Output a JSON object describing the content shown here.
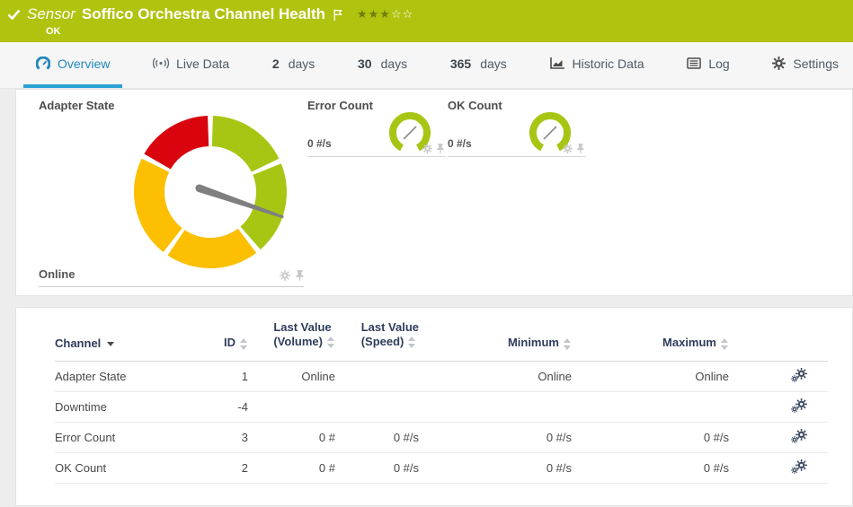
{
  "banner": {
    "type_label": "Sensor",
    "title": "Soffico Orchestra Channel Health",
    "status": "OK",
    "stars_filled": "★★★",
    "stars_empty": "☆☆",
    "color": "#b0c30e"
  },
  "tabs": {
    "overview": "Overview",
    "live_data": "Live Data",
    "days2_num": "2",
    "days2_unit": "days",
    "days30_num": "30",
    "days30_unit": "days",
    "days365_num": "365",
    "days365_unit": "days",
    "historic_data": "Historic Data",
    "log": "Log",
    "settings": "Settings",
    "active_color": "#2187ba"
  },
  "gauges": {
    "main": {
      "title": "Adapter State",
      "value": "Online"
    },
    "error": {
      "title": "Error Count",
      "value": "0 #/s"
    },
    "ok": {
      "title": "OK Count",
      "value": "0 #/s"
    },
    "status_colors": {
      "up_green": "#a7c613",
      "warning_yellow": "#fcbf02",
      "down_red": "#d9040e",
      "needle_gray": "#7f7f7f"
    }
  },
  "table": {
    "headers": {
      "channel": "Channel",
      "id": "ID",
      "last_value_volume_line1": "Last Value",
      "last_value_volume_line2": "(Volume)",
      "last_value_speed_line1": "Last Value",
      "last_value_speed_line2": "(Speed)",
      "minimum": "Minimum",
      "maximum": "Maximum"
    },
    "rows": [
      {
        "channel": "Adapter State",
        "id": "1",
        "last_value_volume": "Online",
        "last_value_speed": "",
        "minimum": "Online",
        "maximum": "Online"
      },
      {
        "channel": "Downtime",
        "id": "-4",
        "last_value_volume": "",
        "last_value_speed": "",
        "minimum": "",
        "maximum": ""
      },
      {
        "channel": "Error Count",
        "id": "3",
        "last_value_volume": "0 #",
        "last_value_speed": "0 #/s",
        "minimum": "0 #/s",
        "maximum": "0 #/s"
      },
      {
        "channel": "OK Count",
        "id": "2",
        "last_value_volume": "0 #",
        "last_value_speed": "0 #/s",
        "minimum": "0 #/s",
        "maximum": "0 #/s"
      }
    ]
  }
}
